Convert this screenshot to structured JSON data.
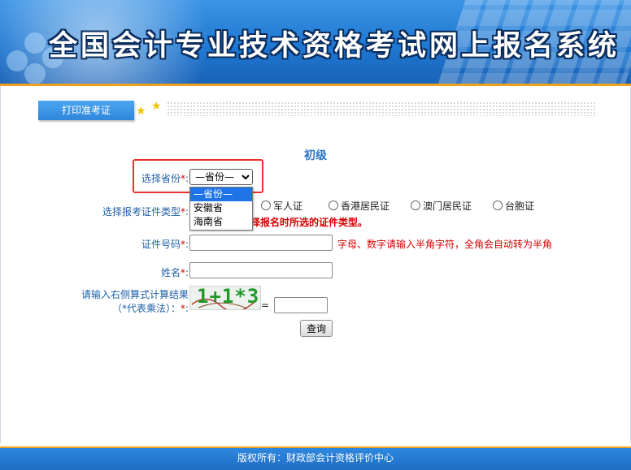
{
  "banner": {
    "title": "全国会计专业技术资格考试网上报名系统"
  },
  "tab": {
    "label": "打印准考证"
  },
  "level": "初级",
  "form": {
    "province_label": "选择省份",
    "province_selected": "—省份—",
    "province_options": [
      "—省份—",
      "安徽省",
      "海南省"
    ],
    "idtype_label": "选择报考证件类型",
    "idtype_options": [
      "军人证",
      "香港居民证",
      "澳门居民证",
      "台胞证"
    ],
    "idtype_warning": "择报名时所选的证件类型。",
    "idnumber_label": "证件号码",
    "idnumber_hint": "字母、数字请输入半角字符，全角会自动转为半角",
    "name_label": "姓名",
    "captcha_label_line1": "请输入右侧算式计算结果",
    "captcha_label_line2": "（*代表乘法）：",
    "captcha_text": "1+1*3",
    "equals": "=",
    "required_mark": "*",
    "colon": ":",
    "query_button": "查询"
  },
  "footer": {
    "text": "版权所有：财政部会计资格评价中心"
  },
  "colors": {
    "accent": "#2a74c5",
    "header_blue": "#1f78d2",
    "orange": "#f0a01e",
    "required_red": "#e00000",
    "highlight_box": "#e8322d"
  }
}
